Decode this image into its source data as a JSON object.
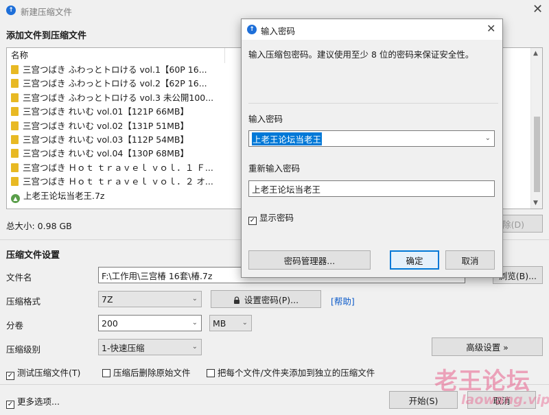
{
  "window": {
    "title": "新建压缩文件"
  },
  "files_section": {
    "heading": "添加文件到压缩文件",
    "column_name": "名称",
    "items": [
      {
        "name": "三宫つばき ふわっとトロける vol.1【60P 16...",
        "type": "folder"
      },
      {
        "name": "三宫つばき ふわっとトロける vol.2【62P 16...",
        "type": "folder"
      },
      {
        "name": "三宫つばき ふわっとトロける vol.3 未公開100...",
        "type": "folder"
      },
      {
        "name": "三宫つばき れいむ vol.01【121P 66MB】",
        "type": "folder"
      },
      {
        "name": "三宫つばき れいむ vol.02【131P 51MB】",
        "type": "folder"
      },
      {
        "name": "三宫つばき れいむ vol.03【112P 54MB】",
        "type": "folder"
      },
      {
        "name": "三宫つばき れいむ vol.04【130P 68MB】",
        "type": "folder"
      },
      {
        "name": "三宫つばき Ｈｏｔ ｔｒａｖｅｌ ｖｏｌ．１ Ｆ...",
        "type": "folder"
      },
      {
        "name": "三宫つばき Ｈｏｔ ｔｒａｖｅｌ ｖｏｌ．２ オ...",
        "type": "folder"
      },
      {
        "name": "上老王论坛当老王.7z",
        "type": "archive"
      }
    ],
    "total_size": "总大小: 0.98 GB",
    "remove_label": "除(D)"
  },
  "settings": {
    "heading": "压缩文件设置",
    "filename_label": "文件名",
    "filename_value": "F:\\工作用\\三宫椿 16套\\椿.7z",
    "browse_label": "浏览(B)...",
    "format_label": "压缩格式",
    "format_value": "7Z",
    "set_password_label": "设置密码(P)...",
    "help_label": "[帮助]",
    "volume_label": "分卷",
    "volume_value": "200",
    "volume_unit": "MB",
    "level_label": "压缩级别",
    "level_value": "1-快速压缩",
    "advanced_label": "高级设置 »",
    "test_label": "测试压缩文件(T)",
    "delete_label": "压缩后删除原始文件",
    "separate_label": "把每个文件/文件夹添加到独立的压缩文件",
    "more_options_label": "更多选项...",
    "start_label": "开始(S)",
    "cancel_label": "取消"
  },
  "dialog": {
    "title": "输入密码",
    "description": "输入压缩包密码。建议使用至少 8 位的密码来保证安全性。",
    "password_label": "输入密码",
    "password_value": "上老王论坛当老王",
    "reenter_label": "重新输入密码",
    "reenter_value": "上老王论坛当老王",
    "show_password_label": "显示密码",
    "manager_label": "密码管理器...",
    "ok_label": "确定",
    "cancel_label": "取消"
  },
  "watermark": {
    "cn": "老王论坛",
    "en": "laowang.vip"
  },
  "colors": {
    "accent": "#0078d7",
    "link": "#0b5ac9",
    "folder": "#e8b923"
  }
}
